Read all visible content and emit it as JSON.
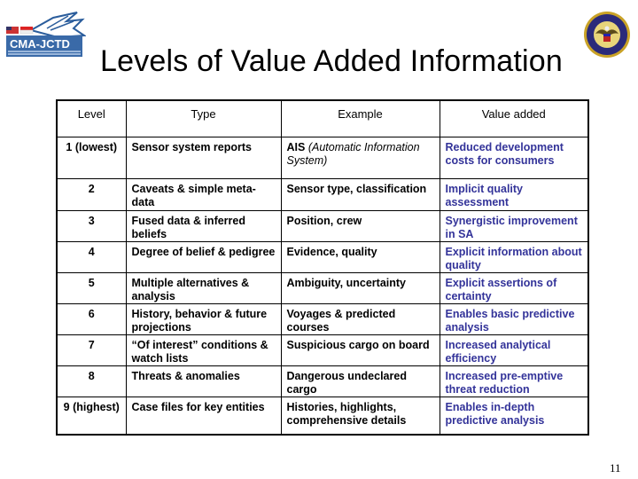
{
  "title": "Levels of Value Added Information",
  "logos": {
    "left": {
      "icon": "cma-jctd-logo",
      "text": "CMA-JCTD"
    },
    "right": {
      "icon": "navy-seal-logo"
    }
  },
  "table": {
    "headers": [
      "Level",
      "Type",
      "Example",
      "Value added"
    ],
    "rows": [
      {
        "level": "1 (lowest)",
        "type": "Sensor system reports",
        "example_bold": "AIS",
        "example_rest": " (Automatic Information System)",
        "value_added": "Reduced development costs for consumers"
      },
      {
        "level": "2",
        "type": "Caveats & simple meta-data",
        "example_bold": "Sensor type, classification",
        "example_rest": "",
        "value_added": "Implicit quality assessment"
      },
      {
        "level": "3",
        "type": "Fused data & inferred beliefs",
        "example_bold": "Position, crew",
        "example_rest": "",
        "value_added": "Synergistic improvement in SA"
      },
      {
        "level": "4",
        "type": "Degree of belief & pedigree",
        "example_bold": "Evidence, quality",
        "example_rest": "",
        "value_added": "Explicit information about quality"
      },
      {
        "level": "5",
        "type": "Multiple alternatives & analysis",
        "example_bold": "Ambiguity, uncertainty",
        "example_rest": "",
        "value_added": "Explicit assertions of certainty"
      },
      {
        "level": "6",
        "type": "History, behavior & future projections",
        "example_bold": "Voyages & predicted courses",
        "example_rest": "",
        "value_added": "Enables basic predictive analysis"
      },
      {
        "level": "7",
        "type": "“Of interest” conditions & watch lists",
        "example_bold": "Suspicious cargo on board",
        "example_rest": "",
        "value_added": "Increased analytical efficiency"
      },
      {
        "level": "8",
        "type": "Threats & anomalies",
        "example_bold": "Dangerous undeclared cargo",
        "example_rest": "",
        "value_added": "Increased pre-emptive threat reduction"
      },
      {
        "level": "9 (highest)",
        "type": "Case files for key entities",
        "example_bold": "Histories, highlights, comprehensive details",
        "example_rest": "",
        "value_added": "Enables in-depth predictive analysis"
      }
    ]
  },
  "colors": {
    "value_added_text": "#333399",
    "text": "#000000",
    "background": "#ffffff"
  },
  "page_number": "11"
}
